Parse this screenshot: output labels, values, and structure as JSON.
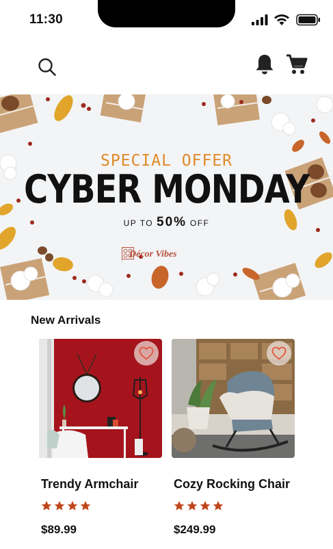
{
  "status_bar": {
    "time": "11:30"
  },
  "banner": {
    "special_offer": "SPECIAL OFFER",
    "headline": "CYBER MONDAY",
    "upto_prefix": "UP TO",
    "discount": "50%",
    "upto_suffix": "OFF",
    "brand_name": "Décor Vibes"
  },
  "section": {
    "title": "New Arrivals"
  },
  "products": [
    {
      "name": "Trendy Armchair",
      "rating": 4,
      "price": "$89.99"
    },
    {
      "name": "Cozy Rocking Chair",
      "rating": 4,
      "price": "$249.99"
    }
  ],
  "colors": {
    "accent": "#b5451b",
    "star": "#c0461b",
    "heart": "#e0563f",
    "offer": "#e08a2a"
  }
}
